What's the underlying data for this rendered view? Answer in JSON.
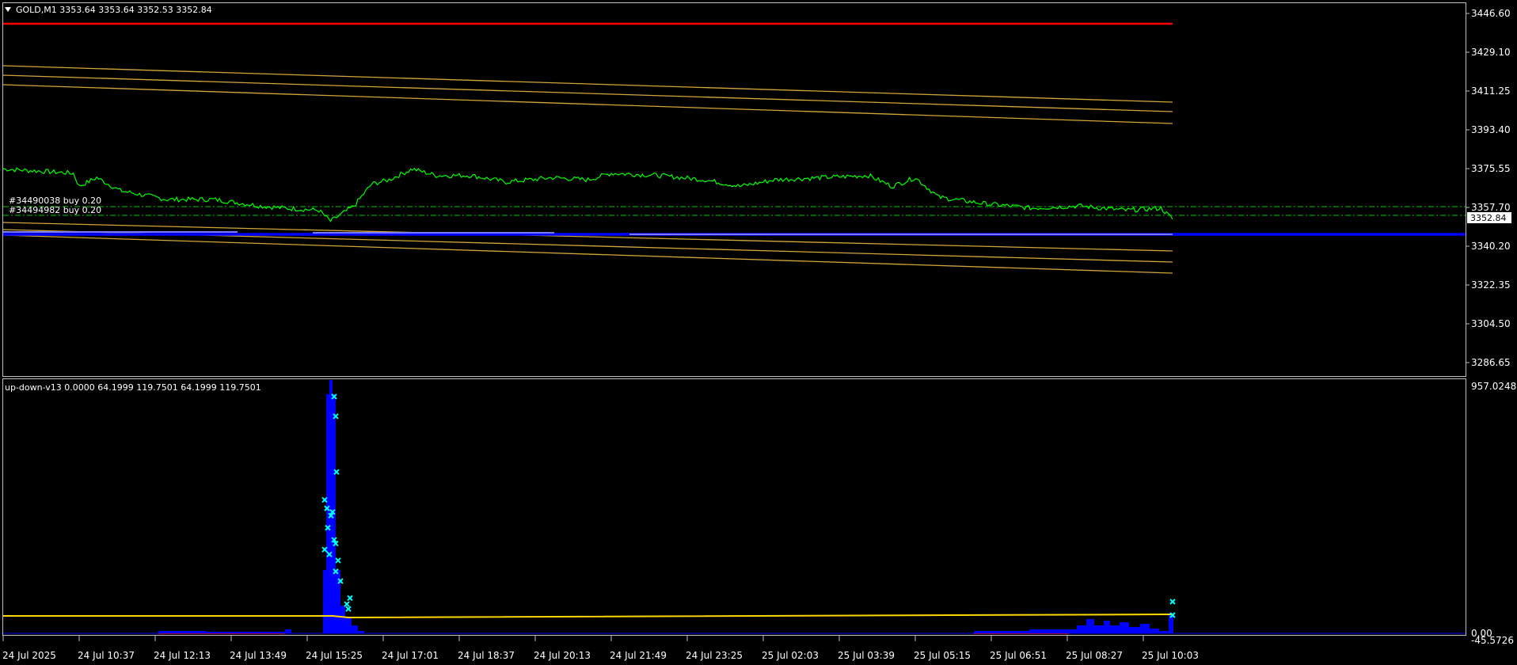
{
  "symbol_header": "GOLD,M1  3353.64 3353.64 3352.53 3352.84",
  "orders": [
    {
      "label": "#34490038 buy 0.20",
      "price": 3357.7
    },
    {
      "label": "#34494982 buy 0.20",
      "price": 3352.84
    }
  ],
  "price_axis": {
    "labels": [
      "3446.60",
      "3429.10",
      "3411.25",
      "3393.40",
      "3375.55",
      "3357.70",
      "3340.20",
      "3322.35",
      "3304.50",
      "3286.65"
    ],
    "current_price": "3352.84"
  },
  "indicator": {
    "header": "up-down-v13 0.0000 64.1999 119.7501 64.1999 119.7501",
    "axis_labels": [
      "957.0248",
      "0.00",
      "-45.5726"
    ]
  },
  "time_axis": {
    "labels": [
      "24 Jul 2025",
      "24 Jul 10:37",
      "24 Jul 12:13",
      "24 Jul 13:49",
      "24 Jul 15:25",
      "24 Jul 17:01",
      "24 Jul 18:37",
      "24 Jul 20:13",
      "24 Jul 21:49",
      "24 Jul 23:25",
      "25 Jul 02:03",
      "25 Jul 03:39",
      "25 Jul 05:15",
      "25 Jul 06:51",
      "25 Jul 08:27",
      "25 Jul 10:03"
    ]
  },
  "colors": {
    "background": "#000000",
    "price_line": "#00ff00",
    "resistance": "#ff0000",
    "channel": "#d4a63a",
    "support": "#0000ff",
    "histogram": "#0000ff",
    "markers": "#00ffff",
    "threshold": "#ffd700"
  },
  "chart_data": {
    "type": "line",
    "price": {
      "ylim": [
        3281,
        3452
      ],
      "series_points": [
        [
          0,
          3376
        ],
        [
          0.06,
          3374
        ],
        [
          0.065,
          3368
        ],
        [
          0.08,
          3372
        ],
        [
          0.1,
          3366
        ],
        [
          0.14,
          3362
        ],
        [
          0.18,
          3362
        ],
        [
          0.22,
          3359
        ],
        [
          0.24,
          3358
        ],
        [
          0.27,
          3357
        ],
        [
          0.28,
          3352
        ],
        [
          0.3,
          3359
        ],
        [
          0.315,
          3369
        ],
        [
          0.33,
          3371
        ],
        [
          0.35,
          3376
        ],
        [
          0.37,
          3373
        ],
        [
          0.4,
          3373
        ],
        [
          0.43,
          3370
        ],
        [
          0.47,
          3372
        ],
        [
          0.5,
          3371
        ],
        [
          0.52,
          3374
        ],
        [
          0.56,
          3373
        ],
        [
          0.6,
          3371
        ],
        [
          0.63,
          3368
        ],
        [
          0.66,
          3371
        ],
        [
          0.7,
          3372
        ],
        [
          0.74,
          3373
        ],
        [
          0.76,
          3368
        ],
        [
          0.78,
          3372
        ],
        [
          0.8,
          3363
        ],
        [
          0.84,
          3360
        ],
        [
          0.88,
          3358
        ],
        [
          0.92,
          3359
        ],
        [
          0.96,
          3357
        ],
        [
          0.99,
          3358
        ],
        [
          1.0,
          3353
        ]
      ],
      "resistance_level": 3443,
      "support_levels": [
        3346,
        3344
      ]
    },
    "indicator": {
      "ylim": [
        -45.5726,
        957.0248
      ],
      "threshold": 64.2,
      "spike_markers": [
        931,
        850,
        620,
        505,
        470,
        455,
        440,
        390,
        340,
        325,
        300,
        280,
        255,
        210,
        170,
        100,
        75,
        55
      ]
    }
  }
}
